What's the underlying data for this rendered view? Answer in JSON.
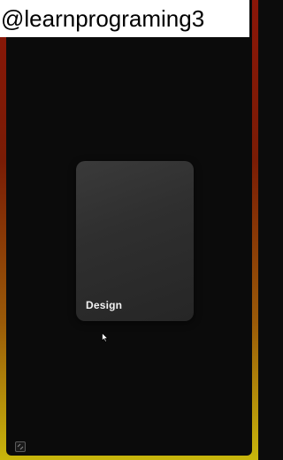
{
  "watermark": {
    "text": "@learnprograming3"
  },
  "card": {
    "label": "Design"
  },
  "icons": {
    "cursor": "pointer-cursor-icon",
    "corner": "expand-icon"
  },
  "colors": {
    "background": "#0b0b0b",
    "card": "#333333",
    "border_top": "#8a1608",
    "border_bottom": "#c8b60c"
  }
}
